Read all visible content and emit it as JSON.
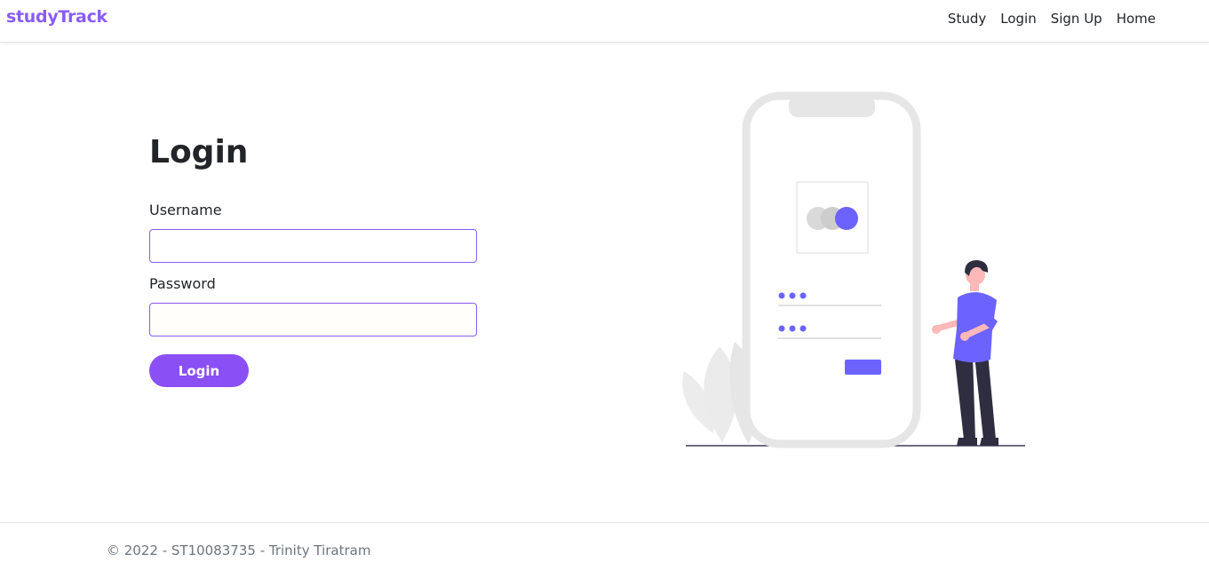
{
  "navbar": {
    "brand": "studyTrack",
    "links": [
      "Study",
      "Login",
      "Sign Up",
      "Home"
    ]
  },
  "login": {
    "title": "Login",
    "username_label": "Username",
    "password_label": "Password",
    "username_value": "",
    "password_value": "",
    "submit_label": "Login"
  },
  "footer": {
    "text": "© 2022 - ST10083735 - Trinity Tiratram"
  },
  "colors": {
    "brand": "#8a5cf5",
    "accent": "#6c63ff",
    "button": "#8a4ff5"
  },
  "illustration": {
    "icon": "phone-login-illustration"
  }
}
